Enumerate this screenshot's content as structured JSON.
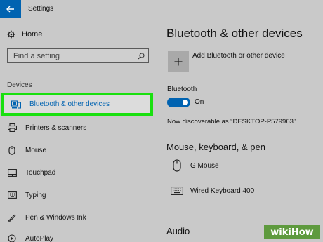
{
  "window": {
    "title": "Settings",
    "back_icon": "arrow-left-icon"
  },
  "sidebar": {
    "home_label": "Home",
    "search_placeholder": "Find a setting",
    "section_label": "Devices",
    "items": [
      {
        "label": "Bluetooth & other devices",
        "icon": "bluetooth-devices-icon",
        "selected": true
      },
      {
        "label": "Printers & scanners",
        "icon": "printer-icon",
        "selected": false
      },
      {
        "label": "Mouse",
        "icon": "mouse-icon",
        "selected": false
      },
      {
        "label": "Touchpad",
        "icon": "touchpad-icon",
        "selected": false
      },
      {
        "label": "Typing",
        "icon": "keyboard-icon",
        "selected": false
      },
      {
        "label": "Pen & Windows Ink",
        "icon": "pen-icon",
        "selected": false
      },
      {
        "label": "AutoPlay",
        "icon": "autoplay-icon",
        "selected": false
      }
    ]
  },
  "main": {
    "title": "Bluetooth & other devices",
    "add_device_label": "Add Bluetooth or other device",
    "bluetooth_label": "Bluetooth",
    "bluetooth_state": "On",
    "bluetooth_enabled": true,
    "discoverable_text": "Now discoverable as “DESKTOP-P579963”",
    "mouse_keyboard_heading": "Mouse, keyboard, & pen",
    "devices": [
      {
        "name": "G Mouse",
        "icon": "mouse-icon"
      },
      {
        "name": "Wired Keyboard 400",
        "icon": "keyboard-icon"
      }
    ],
    "audio_heading": "Audio"
  },
  "colors": {
    "accent": "#0063b1",
    "highlight_border": "#19e00f",
    "background": "#c9c9c9",
    "watermark": "#5e9a3e"
  },
  "watermark": {
    "text": "wikiHow"
  }
}
